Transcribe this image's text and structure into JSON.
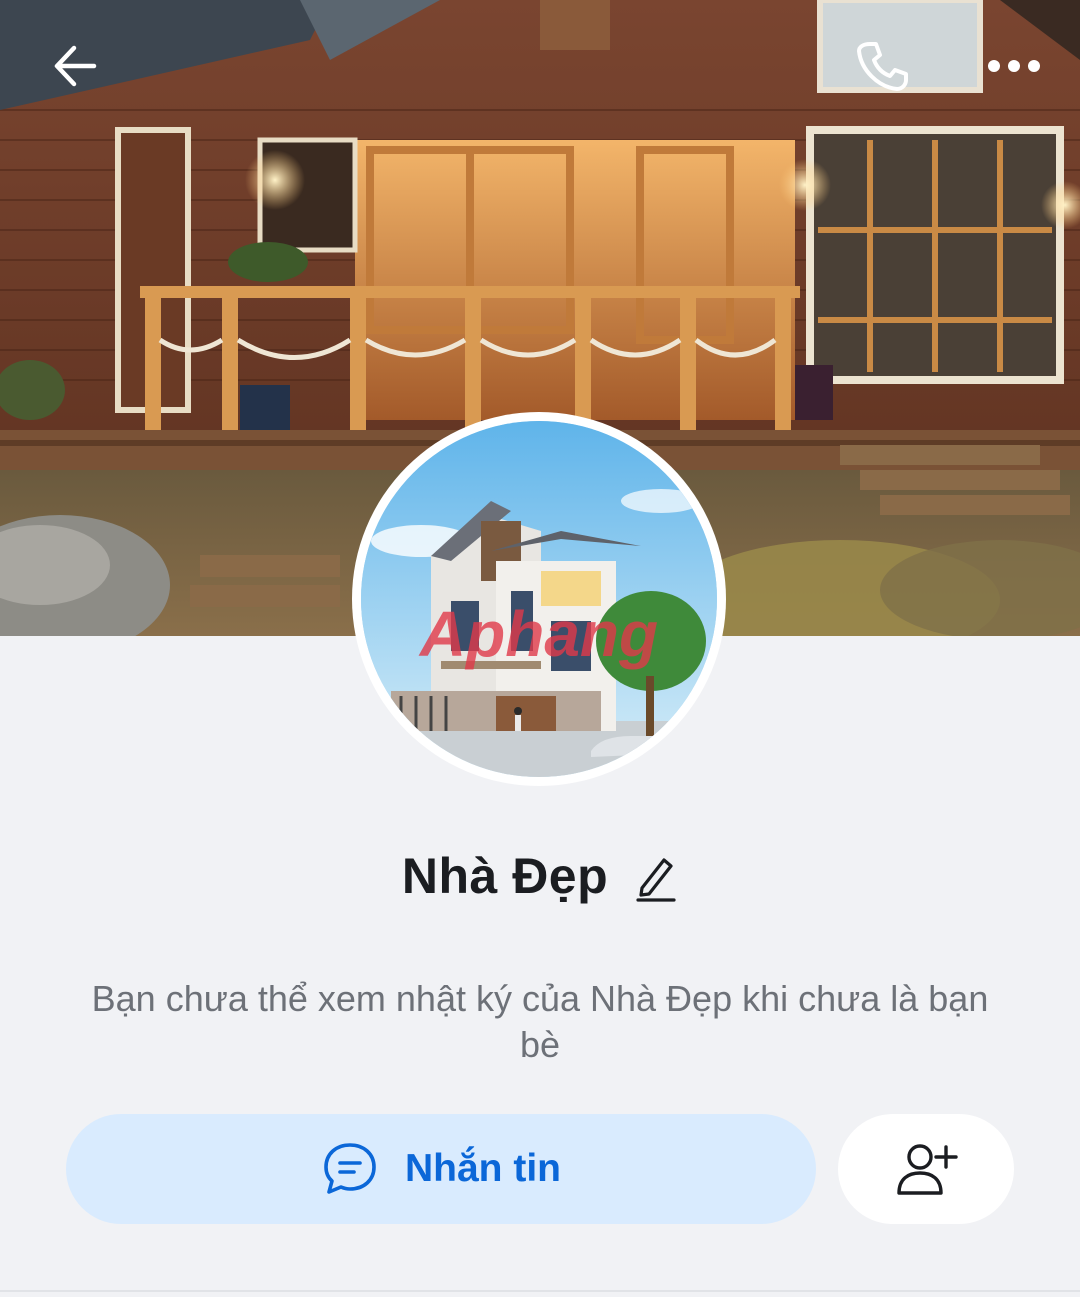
{
  "icons": {
    "back": "arrow-left",
    "call": "phone",
    "more": "more-horizontal",
    "edit": "pencil",
    "message": "chat-bubble",
    "add_friend": "user-plus"
  },
  "avatar": {
    "watermark": "Aphang"
  },
  "profile": {
    "name": "Nhà Đẹp",
    "notice": "Bạn chưa thể xem nhật ký của Nhà Đẹp khi chưa là bạn bè"
  },
  "actions": {
    "message_label": "Nhắn tin"
  },
  "colors": {
    "accent": "#0b67d8",
    "message_button_bg": "#d9ebfe",
    "page_bg": "#f1f2f5"
  }
}
